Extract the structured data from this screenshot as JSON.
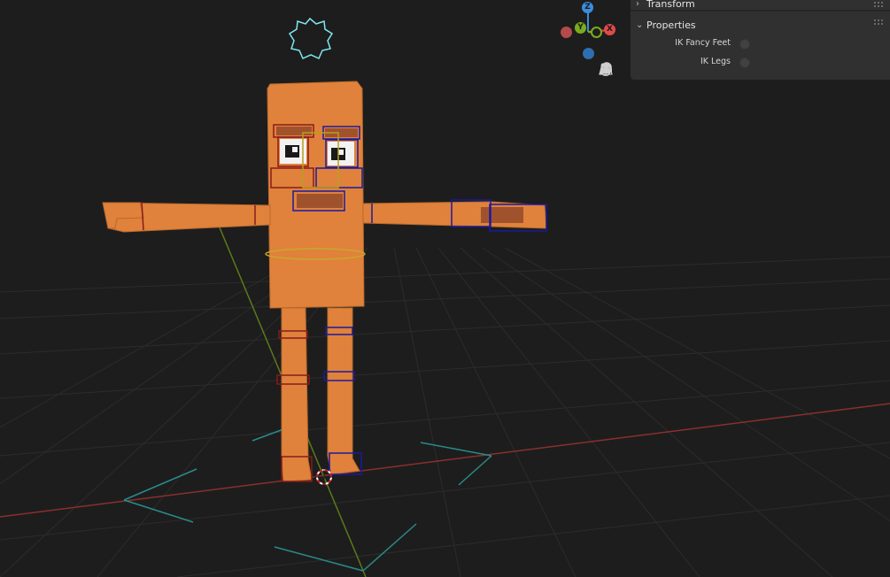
{
  "sidebar": {
    "transform_label": "Transform",
    "properties_label": "Properties",
    "properties": [
      {
        "label": "IK Fancy Feet",
        "checked": false
      },
      {
        "label": "IK Legs",
        "checked": false
      }
    ]
  },
  "gizmo": {
    "axes": [
      {
        "label": "Z",
        "color": "#3a8ddc"
      },
      {
        "label": "Y",
        "color": "#7bab1e"
      },
      {
        "label": "X",
        "color": "#e24a4a"
      }
    ],
    "tools": [
      "zoom-icon",
      "hand-pan-icon",
      "camera-icon",
      "grid-perspective-icon"
    ]
  },
  "colors": {
    "background": "#1d1d1d",
    "grid": "#2b2b2b",
    "x_axis": "#8a2f2f",
    "y_axis": "#5a7a1a",
    "mesh": "#e0823b",
    "bone_selected_left": "#8a1a1a",
    "bone_selected_right": "#1a1aa0",
    "root_control": "#7fe6f0",
    "ik_control": "#2a8a8a"
  }
}
